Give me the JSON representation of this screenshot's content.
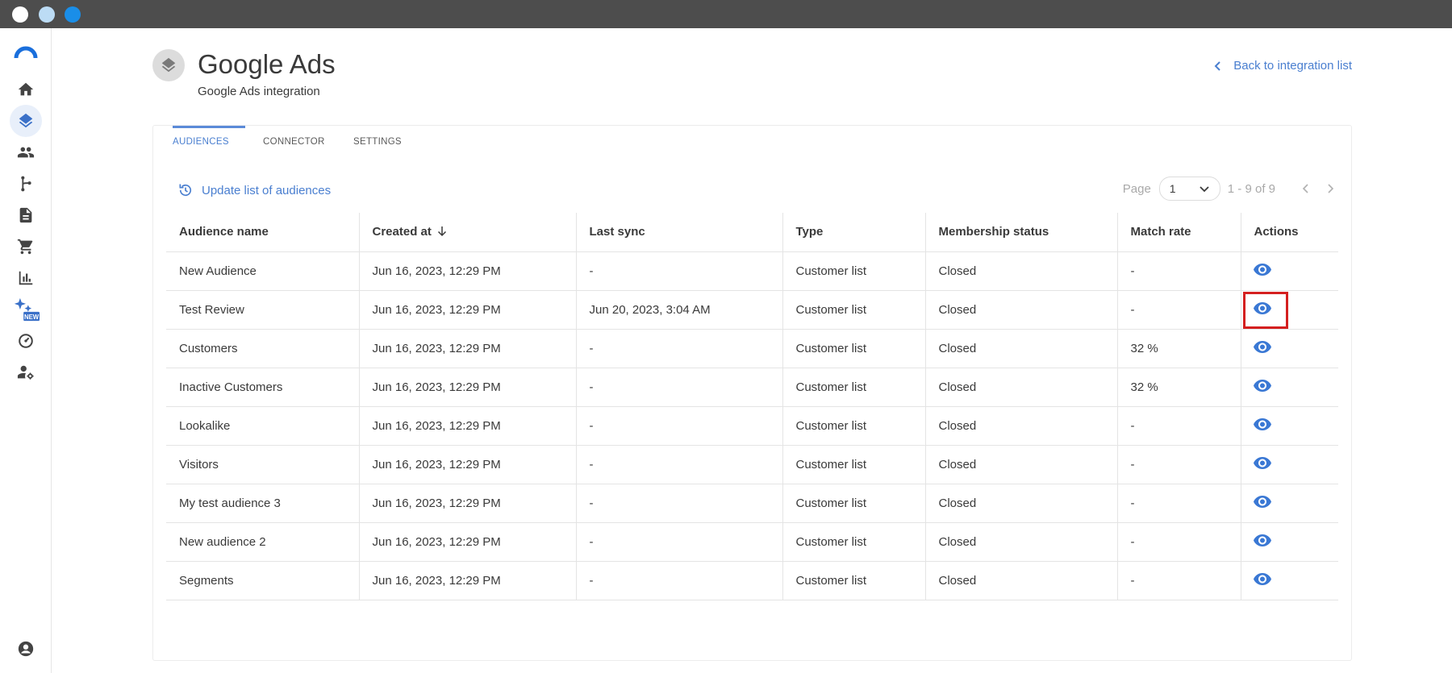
{
  "window": {
    "controls": [
      "close",
      "minimize",
      "maximize"
    ]
  },
  "sidebar": {
    "logo": "brand-logo",
    "items": [
      {
        "name": "home-icon"
      },
      {
        "name": "layers-icon",
        "active": true
      },
      {
        "name": "people-icon"
      },
      {
        "name": "flow-icon"
      },
      {
        "name": "document-icon"
      },
      {
        "name": "cart-icon"
      },
      {
        "name": "bar-chart-icon"
      },
      {
        "name": "sparkles-new-icon",
        "badge": "NEW"
      },
      {
        "name": "dashboard-icon"
      },
      {
        "name": "user-settings-icon"
      }
    ],
    "bottom": {
      "name": "account-icon"
    }
  },
  "header": {
    "title": "Google Ads",
    "subtitle": "Google Ads integration",
    "back_link": "Back to integration list"
  },
  "tabs": [
    {
      "label": "AUDIENCES",
      "active": true
    },
    {
      "label": "CONNECTOR"
    },
    {
      "label": "SETTINGS"
    }
  ],
  "toolbar": {
    "update_label": "Update list of audiences"
  },
  "pager": {
    "page_label": "Page",
    "page_value": "1",
    "range": "1 - 9 of 9"
  },
  "table": {
    "columns": [
      "Audience name",
      "Created at",
      "Last sync",
      "Type",
      "Membership status",
      "Match rate",
      "Actions"
    ],
    "rows": [
      [
        "New Audience",
        "Jun 16, 2023, 12:29 PM",
        "-",
        "Customer list",
        "Closed",
        "-"
      ],
      [
        "Test Review",
        "Jun 16, 2023, 12:29 PM",
        "Jun 20, 2023, 3:04 AM",
        "Customer list",
        "Closed",
        "-"
      ],
      [
        "Customers",
        "Jun 16, 2023, 12:29 PM",
        "-",
        "Customer list",
        "Closed",
        "32 %"
      ],
      [
        "Inactive Customers",
        "Jun 16, 2023, 12:29 PM",
        "-",
        "Customer list",
        "Closed",
        "32 %"
      ],
      [
        "Lookalike",
        "Jun 16, 2023, 12:29 PM",
        "-",
        "Customer list",
        "Closed",
        "-"
      ],
      [
        "Visitors",
        "Jun 16, 2023, 12:29 PM",
        "-",
        "Customer list",
        "Closed",
        "-"
      ],
      [
        "My test audience 3",
        "Jun 16, 2023, 12:29 PM",
        "-",
        "Customer list",
        "Closed",
        "-"
      ],
      [
        "New audience 2",
        "Jun 16, 2023, 12:29 PM",
        "-",
        "Customer list",
        "Closed",
        "-"
      ],
      [
        "Segments",
        "Jun 16, 2023, 12:29 PM",
        "-",
        "Customer list",
        "Closed",
        "-"
      ]
    ],
    "highlighted_row": 1
  },
  "colors": {
    "accent": "#4a7fd0",
    "highlight": "#d41f1f",
    "titlebar": "#4d4d4d"
  }
}
